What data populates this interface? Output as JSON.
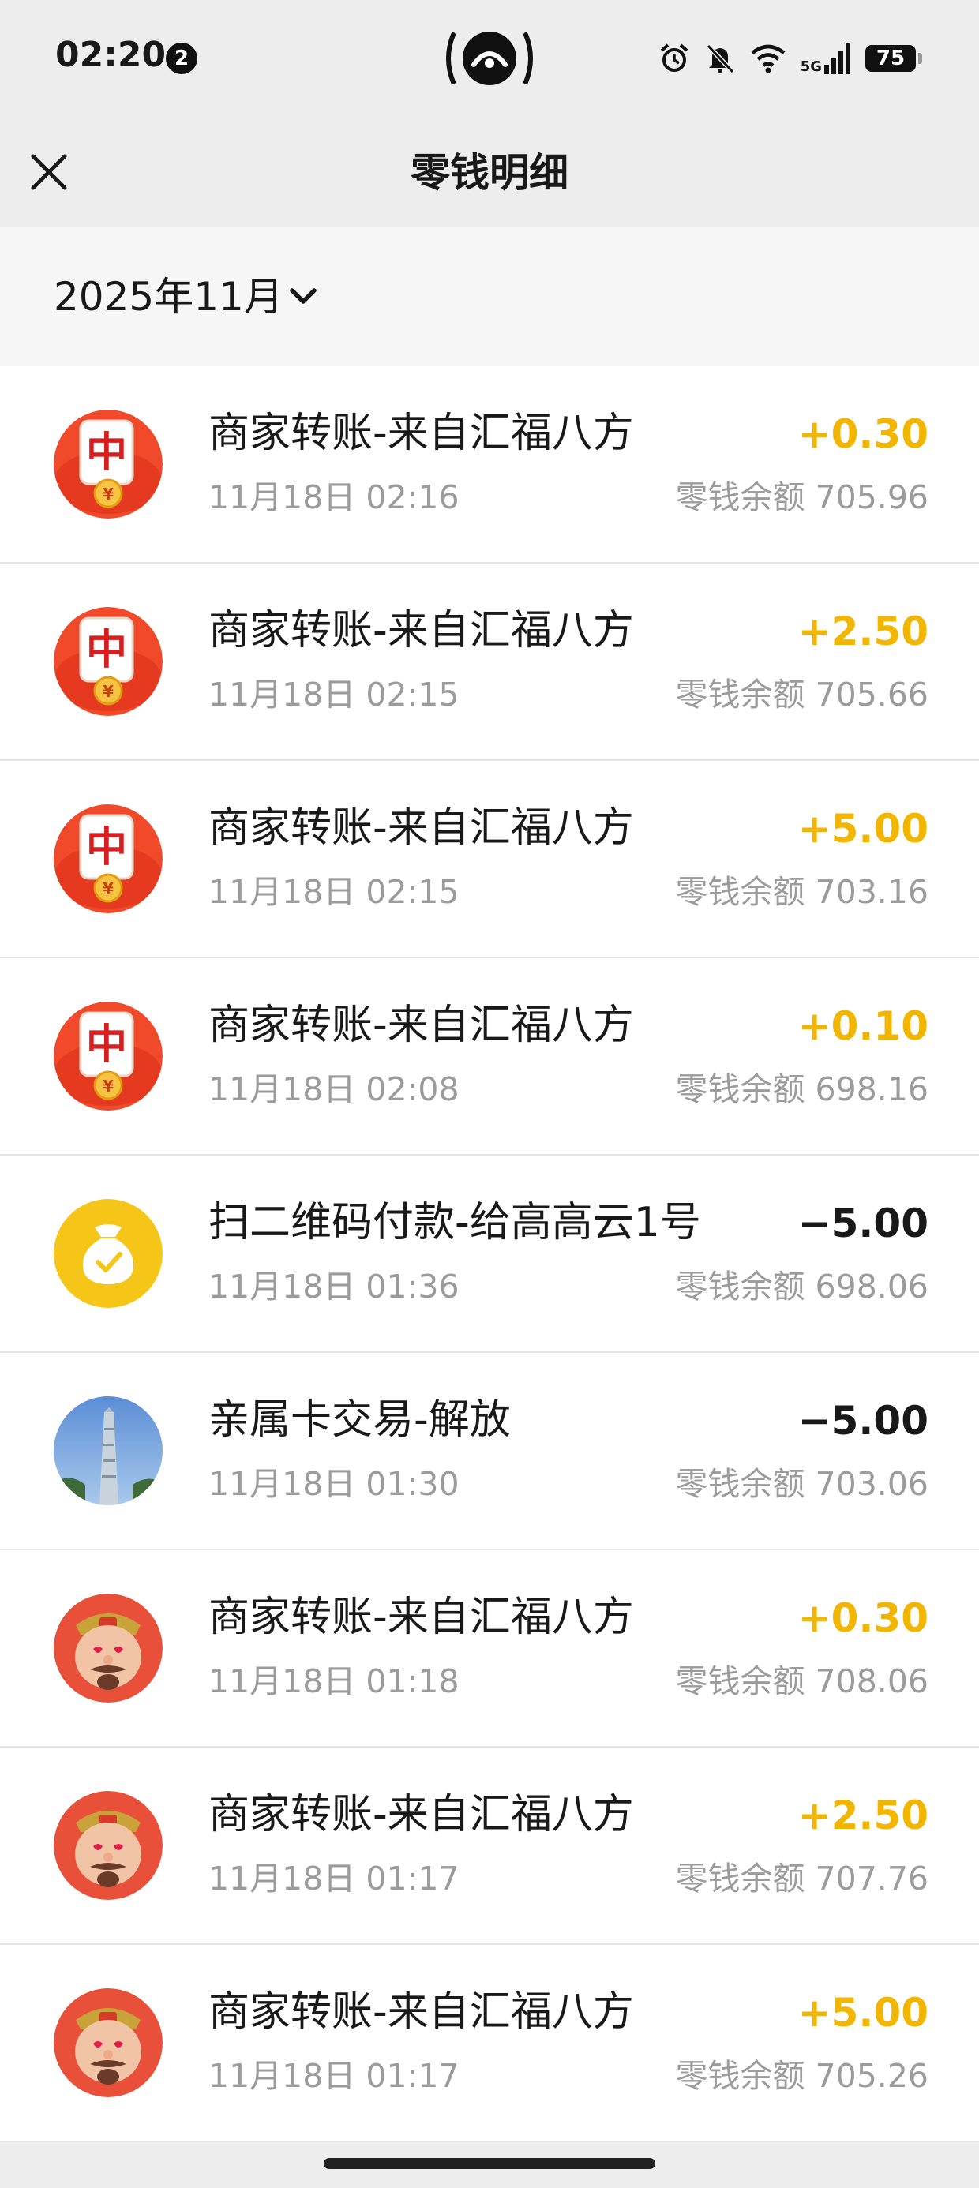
{
  "status_bar": {
    "time": "02:20",
    "notification_count": "2",
    "network": "5G",
    "battery": "75"
  },
  "nav": {
    "title": "零钱明细",
    "close_icon": "close-icon"
  },
  "month_selector": {
    "label": "2025年11月",
    "icon": "chevron-down-icon"
  },
  "transactions": [
    {
      "title": "商家转账-来自汇福八方",
      "time": "11月18日 02:16",
      "amount": "+0.30",
      "type": "income",
      "balance": "零钱余额 705.96",
      "avatar": "mahjong-red-packet"
    },
    {
      "title": "商家转账-来自汇福八方",
      "time": "11月18日 02:15",
      "amount": "+2.50",
      "type": "income",
      "balance": "零钱余额 705.66",
      "avatar": "mahjong-red-packet"
    },
    {
      "title": "商家转账-来自汇福八方",
      "time": "11月18日 02:15",
      "amount": "+5.00",
      "type": "income",
      "balance": "零钱余额 703.16",
      "avatar": "mahjong-red-packet"
    },
    {
      "title": "商家转账-来自汇福八方",
      "time": "11月18日 02:08",
      "amount": "+0.10",
      "type": "income",
      "balance": "零钱余额 698.16",
      "avatar": "mahjong-red-packet"
    },
    {
      "title": "扫二维码付款-给高高云1号",
      "time": "11月18日 01:36",
      "amount": "−5.00",
      "type": "expense",
      "balance": "零钱余额 698.06",
      "avatar": "money-bag"
    },
    {
      "title": "亲属卡交易-解放",
      "time": "11月18日 01:30",
      "amount": "−5.00",
      "type": "expense",
      "balance": "零钱余额 703.06",
      "avatar": "building-photo"
    },
    {
      "title": "商家转账-来自汇福八方",
      "time": "11月18日 01:18",
      "amount": "+0.30",
      "type": "income",
      "balance": "零钱余额 708.06",
      "avatar": "god-of-wealth"
    },
    {
      "title": "商家转账-来自汇福八方",
      "time": "11月18日 01:17",
      "amount": "+2.50",
      "type": "income",
      "balance": "零钱余额 707.76",
      "avatar": "god-of-wealth"
    },
    {
      "title": "商家转账-来自汇福八方",
      "time": "11月18日 01:17",
      "amount": "+5.00",
      "type": "income",
      "balance": "零钱余额 705.26",
      "avatar": "god-of-wealth"
    }
  ],
  "colors": {
    "income": "#f2b600",
    "expense": "#191919",
    "secondary_text": "#9b9b9b",
    "header_bg": "#ededed"
  }
}
